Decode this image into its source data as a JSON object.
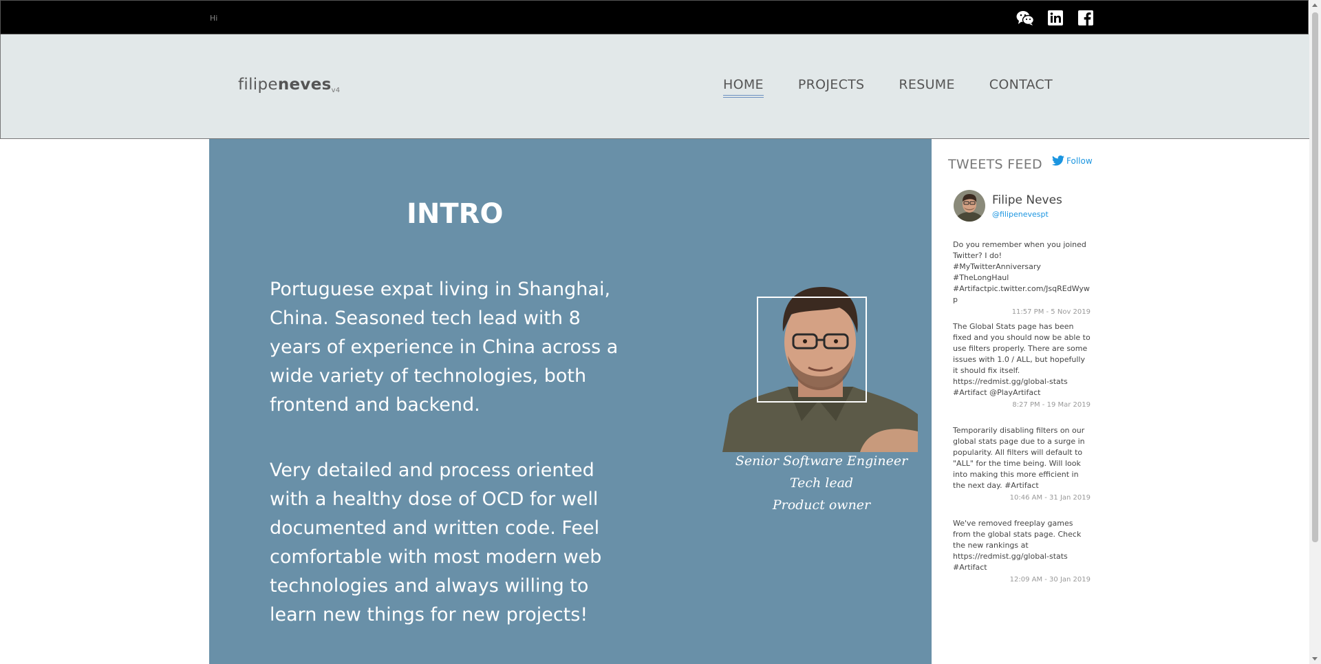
{
  "topbar": {
    "greeting": "Hi",
    "social_icons": [
      "wechat-icon",
      "linkedin-icon",
      "facebook-icon"
    ]
  },
  "header": {
    "logo_light": "filipe",
    "logo_bold": "neves",
    "logo_version": "v4",
    "nav": [
      {
        "label": "HOME",
        "active": true
      },
      {
        "label": "PROJECTS",
        "active": false
      },
      {
        "label": "RESUME",
        "active": false
      },
      {
        "label": "CONTACT",
        "active": false
      }
    ]
  },
  "intro": {
    "title": "INTRO",
    "paragraph1": "Portuguese expat living in Shanghai, China. Seasoned tech lead with 8 years of experience in China across a wide variety of technologies, both frontend and backend.",
    "paragraph2": "Very detailed and process oriented with a healthy dose of OCD for well documented and written code. Feel comfortable with most modern web technologies and always willing to learn new things for new projects!",
    "roles": [
      "Senior Software Engineer",
      "Tech lead",
      "Product owner"
    ]
  },
  "tweets_feed": {
    "title": "TWEETS FEED",
    "follow_label": "Follow",
    "profile": {
      "name": "Filipe Neves",
      "handle": "@filipenevespt"
    },
    "tweets": [
      {
        "text": "Do you remember when you joined Twitter? I do! #MyTwitterAnniversary #TheLongHaul #Artifactpic.twitter.com/JsqREdWywp",
        "time": "11:57 PM - 5 Nov 2019"
      },
      {
        "text": "The Global Stats page has been fixed and you should now be able to use filters properly. There are some issues with 1.0 / ALL, but hopefully it should fix itself. https://redmist.gg/global-stats #Artifact @PlayArtifact",
        "time": "8:27 PM - 19 Mar 2019"
      },
      {
        "text": "Temporarily disabling filters on our global stats page due to a surge in popularity. All filters will default to \"ALL\" for the time being. Will look into making this more efficient in the next day. #Artifact",
        "time": "10:46 AM - 31 Jan 2019"
      },
      {
        "text": "We've removed freeplay games from the global stats page. Check the new rankings at https://redmist.gg/global-stats #Artifact",
        "time": "12:09 AM - 30 Jan 2019"
      }
    ]
  },
  "colors": {
    "topbar": "#000000",
    "navbar": "#e2e8e9",
    "intro_bg": "#6990a8",
    "link": "#1b95e0"
  }
}
